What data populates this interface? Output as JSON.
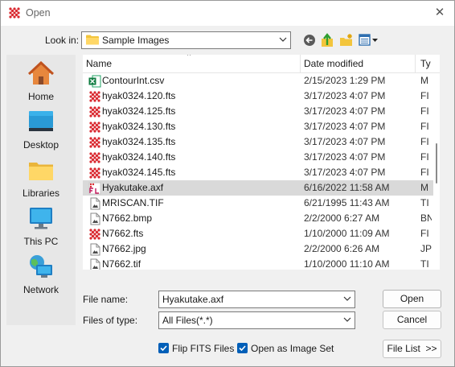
{
  "window": {
    "title": "Open",
    "close_glyph": "✕"
  },
  "lookin": {
    "label": "Look in:",
    "value": "Sample Images"
  },
  "toolbar": {
    "back_icon": "back-arrow-icon",
    "up_icon": "up-folder-icon",
    "new_folder_icon": "new-folder-icon",
    "views_icon": "view-menu-icon"
  },
  "places": [
    {
      "label": "Home",
      "icon": "home-icon"
    },
    {
      "label": "Desktop",
      "icon": "desktop-icon"
    },
    {
      "label": "Libraries",
      "icon": "libraries-icon"
    },
    {
      "label": "This PC",
      "icon": "this-pc-icon"
    },
    {
      "label": "Network",
      "icon": "network-icon"
    }
  ],
  "columns": {
    "name": "Name",
    "date": "Date modified",
    "type": "Ty"
  },
  "files": [
    {
      "name": "ContourInt.csv",
      "date": "2/15/2023 1:29 PM",
      "type": "M",
      "icon": "excel-csv-icon"
    },
    {
      "name": "hyak0324.120.fts",
      "date": "3/17/2023 4:07 PM",
      "type": "FI",
      "icon": "fits-icon"
    },
    {
      "name": "hyak0324.125.fts",
      "date": "3/17/2023 4:07 PM",
      "type": "FI",
      "icon": "fits-icon"
    },
    {
      "name": "hyak0324.130.fts",
      "date": "3/17/2023 4:07 PM",
      "type": "FI",
      "icon": "fits-icon"
    },
    {
      "name": "hyak0324.135.fts",
      "date": "3/17/2023 4:07 PM",
      "type": "FI",
      "icon": "fits-icon"
    },
    {
      "name": "hyak0324.140.fts",
      "date": "3/17/2023 4:07 PM",
      "type": "FI",
      "icon": "fits-icon"
    },
    {
      "name": "hyak0324.145.fts",
      "date": "3/17/2023 4:07 PM",
      "type": "FI",
      "icon": "fits-icon"
    },
    {
      "name": "Hyakutake.axf",
      "date": "6/16/2022 11:58 AM",
      "type": "M",
      "icon": "axf-icon",
      "selected": true
    },
    {
      "name": "MRISCAN.TIF",
      "date": "6/21/1995 11:43 AM",
      "type": "TI",
      "icon": "image-file-icon"
    },
    {
      "name": "N7662.bmp",
      "date": "2/2/2000 6:27 AM",
      "type": "BN",
      "icon": "image-file-icon"
    },
    {
      "name": "N7662.fts",
      "date": "1/10/2000 11:09 AM",
      "type": "FI",
      "icon": "fits-icon"
    },
    {
      "name": "N7662.jpg",
      "date": "2/2/2000 6:26 AM",
      "type": "JP",
      "icon": "image-file-icon"
    },
    {
      "name": "N7662.tif",
      "date": "1/10/2000 11:10 AM",
      "type": "TI",
      "icon": "image-file-icon"
    }
  ],
  "filename": {
    "label": "File name:",
    "value": "Hyakutake.axf"
  },
  "filetype": {
    "label": "Files of type:",
    "value": "All Files(*.*)"
  },
  "buttons": {
    "open": "Open",
    "cancel": "Cancel",
    "file_list": "File List  >>"
  },
  "options": {
    "flip": {
      "label": "Flip FITS Files",
      "checked": true
    },
    "image_set": {
      "label": "Open as Image Set",
      "checked": true
    }
  },
  "colors": {
    "accent": "#005fb8",
    "selected_row": "#d9d9d9",
    "fits_red": "#d9272e"
  }
}
